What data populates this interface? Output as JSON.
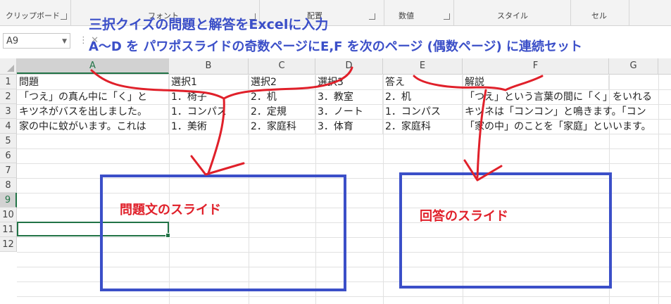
{
  "ribbon": {
    "groups": [
      {
        "label": "クリップボード"
      },
      {
        "label": "フォント"
      },
      {
        "label": "配置"
      },
      {
        "label": "数値"
      },
      {
        "label": "スタイル"
      },
      {
        "label": "セル"
      }
    ]
  },
  "formula_bar": {
    "name_box": "A9",
    "formula": ""
  },
  "columns": [
    "A",
    "B",
    "C",
    "D",
    "E",
    "F",
    "G"
  ],
  "rows": [
    "1",
    "2",
    "3",
    "4",
    "5",
    "6",
    "7",
    "8",
    "9",
    "10",
    "11",
    "12"
  ],
  "cells": {
    "r1": [
      "問題",
      "選択1",
      "選択2",
      "選択3",
      "答え",
      "解説"
    ],
    "r2": [
      "「つえ」の真ん中に「く」と",
      "1．椅子",
      "2．机",
      "3．教室",
      "2．机",
      "「つえ」という言葉の間に「く」をいれる"
    ],
    "r3": [
      "キツネがバスを出しました。",
      "1．コンパス",
      "2．定規",
      "3．ノート",
      "1．コンパス",
      "キツネは「コンコン」と鳴きます。「コン"
    ],
    "r4": [
      "家の中に蚊がいます。これは",
      "1．美術",
      "2．家庭科",
      "3．体育",
      "2．家庭科",
      "「家の中」のことを「家庭」といいます。"
    ]
  },
  "annotations": {
    "title_line1": "三択クイズの問題と解答をExcelに入力",
    "title_line2": "A～D を パワポスライドの奇数ページにE,F を次のページ (偶数ページ) に連続セット",
    "left_box_label": "問題文のスライド",
    "right_box_label": "回答のスライド"
  },
  "colors": {
    "annotation_blue": "#3b4fc8",
    "annotation_red": "#e0202a",
    "excel_green": "#217346"
  }
}
